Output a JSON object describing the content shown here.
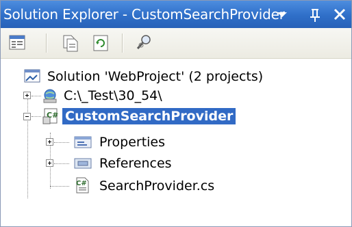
{
  "window": {
    "title": "Solution Explorer - CustomSearchProvider",
    "buttons": {
      "dropdown_icon": "chevron-down-icon",
      "pin_icon": "pin-icon",
      "close_icon": "close-icon"
    }
  },
  "toolbar": {
    "tools": [
      {
        "icon": "properties-icon"
      },
      {
        "icon": "show-all-files-icon"
      },
      {
        "icon": "refresh-icon"
      },
      {
        "icon": "find-icon"
      }
    ]
  },
  "tree": {
    "solution_label": "Solution 'WebProject' (2 projects)",
    "website_label": "C:\\_Test\\30_54\\",
    "project_label": "CustomSearchProvider",
    "properties_label": "Properties",
    "references_label": "References",
    "file_label": "SearchProvider.cs"
  },
  "colors": {
    "title_bar": "#2f6fc8",
    "selection": "#316ac5"
  }
}
